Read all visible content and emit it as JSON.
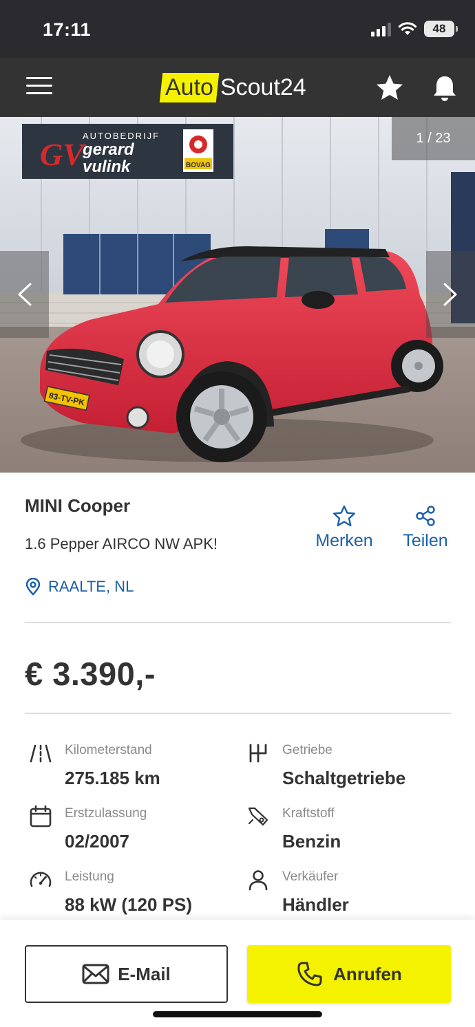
{
  "status_bar": {
    "time": "17:11",
    "battery": "48"
  },
  "header": {
    "logo_auto": "Auto",
    "logo_scout": "Scout24",
    "icons": [
      "menu-icon",
      "star-icon",
      "bell-icon"
    ]
  },
  "gallery": {
    "counter": "1 / 23",
    "sign_line1": "AUTOBEDRIJF",
    "sign_line2": "gerard",
    "sign_line3": "vulink",
    "sign_badge": "BOVAG",
    "plate": "83-TV-PK"
  },
  "listing": {
    "title": "MINI Cooper",
    "subtitle": "1.6 Pepper AIRCO NW APK!",
    "location": "RAALTE, NL",
    "price": "€ 3.390,-",
    "save_label": "Merken",
    "share_label": "Teilen"
  },
  "specs": [
    {
      "label": "Kilometerstand",
      "value": "275.185 km",
      "icon": "road-icon"
    },
    {
      "label": "Getriebe",
      "value": "Schaltgetriebe",
      "icon": "gearshift-icon"
    },
    {
      "label": "Erstzulassung",
      "value": "02/2007",
      "icon": "calendar-icon"
    },
    {
      "label": "Kraftstoff",
      "value": "Benzin",
      "icon": "fuel-nozzle-icon"
    },
    {
      "label": "Leistung",
      "value": "88 kW (120 PS)",
      "icon": "speedometer-icon"
    },
    {
      "label": "Verkäufer",
      "value": "Händler",
      "icon": "person-icon"
    }
  ],
  "actions": {
    "email_label": "E-Mail",
    "call_label": "Anrufen"
  },
  "colors": {
    "brand_yellow": "#f5f200",
    "header_dark": "#333333",
    "link_blue": "#1a5fa8"
  }
}
